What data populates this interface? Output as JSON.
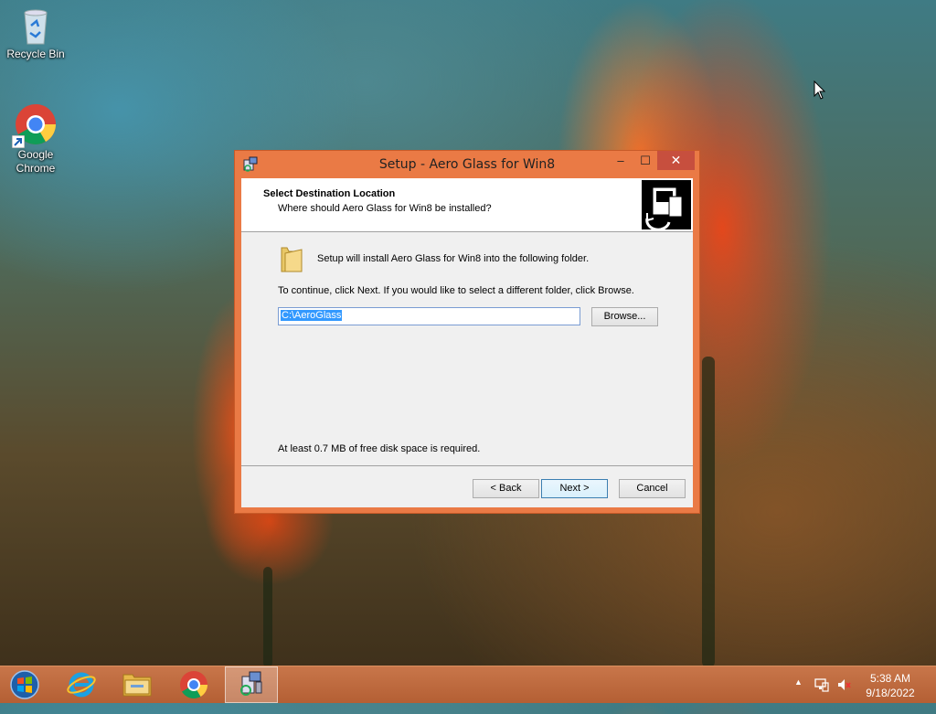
{
  "desktop": {
    "icons": [
      {
        "label": "Recycle Bin",
        "icon": "recycle-bin-icon"
      },
      {
        "label": "Google Chrome",
        "icon": "chrome-icon"
      }
    ]
  },
  "window": {
    "title": "Setup - Aero Glass for Win8",
    "controls": {
      "minimize": "–",
      "maximize": "☐",
      "close": "✕"
    },
    "header": {
      "title": "Select Destination Location",
      "subtitle": "Where should Aero Glass for Win8 be installed?"
    },
    "install_text": "Setup will install Aero Glass for Win8 into the following folder.",
    "continue_text": "To continue, click Next. If you would like to select a different folder, click Browse.",
    "path_value": "C:\\AeroGlass",
    "browse_label": "Browse...",
    "space_text": "At least 0.7 MB of free disk space is required.",
    "buttons": {
      "back": "< Back",
      "next": "Next >",
      "cancel": "Cancel"
    }
  },
  "taskbar": {
    "items": [
      "start-icon",
      "internet-explorer-icon",
      "file-explorer-icon",
      "chrome-icon",
      "setup-icon"
    ],
    "tray": {
      "chevron": "▲"
    },
    "clock": {
      "time": "5:38 AM",
      "date": "9/18/2022"
    }
  },
  "colors": {
    "window_frame": "#ea7a45",
    "close_button": "#c74f3e",
    "taskbar": "#b45f34"
  }
}
